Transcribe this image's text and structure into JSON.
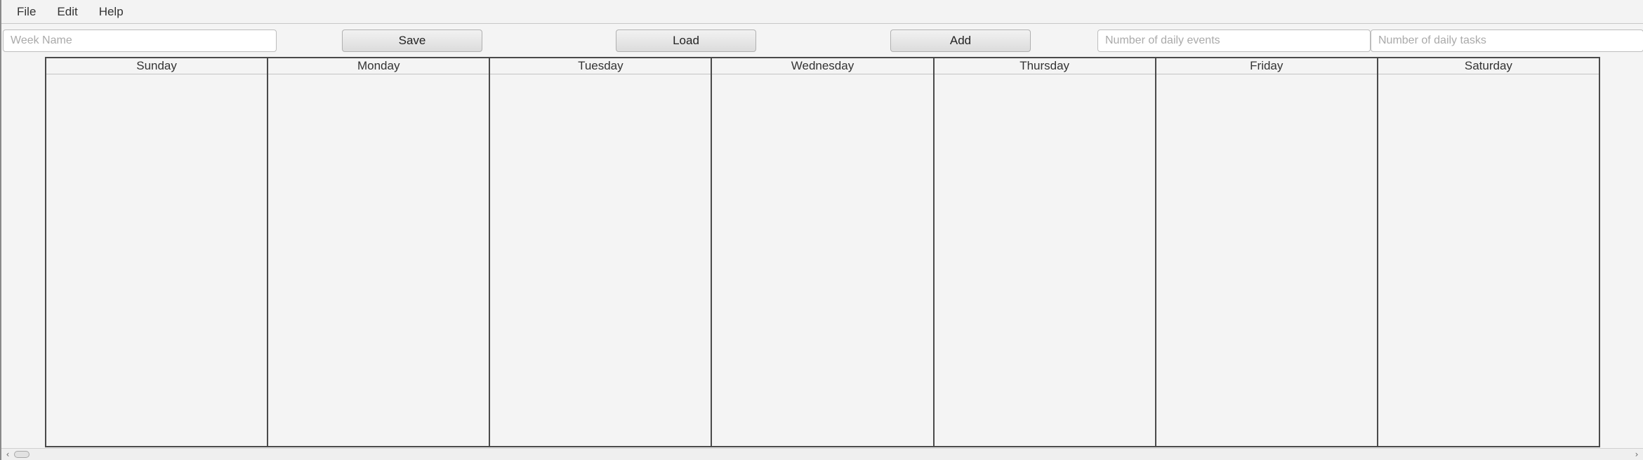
{
  "menubar": {
    "items": [
      {
        "label": "File"
      },
      {
        "label": "Edit"
      },
      {
        "label": "Help"
      }
    ]
  },
  "toolbar": {
    "week_name_placeholder": "Week Name",
    "week_name_value": "",
    "save_label": "Save",
    "load_label": "Load",
    "add_label": "Add",
    "daily_events_placeholder": "Number of daily events",
    "daily_events_value": "",
    "daily_tasks_placeholder": "Number of daily tasks",
    "daily_tasks_value": ""
  },
  "calendar": {
    "days": [
      {
        "label": "Sunday"
      },
      {
        "label": "Monday"
      },
      {
        "label": "Tuesday"
      },
      {
        "label": "Wednesday"
      },
      {
        "label": "Thursday"
      },
      {
        "label": "Friday"
      },
      {
        "label": "Saturday"
      }
    ]
  },
  "scrollbar": {
    "left_arrow_icon": "chevron-left-icon",
    "right_arrow_icon": "chevron-right-icon"
  },
  "colors": {
    "background": "#f4f4f4",
    "grid_border": "#4a4a4a",
    "text": "#333333",
    "placeholder": "#aaaaaa"
  }
}
